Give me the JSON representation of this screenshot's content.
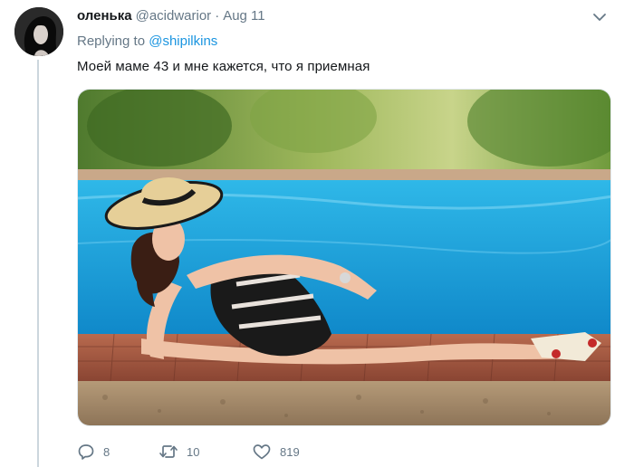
{
  "tweet": {
    "author_name": "оленька",
    "author_handle": "@acidwarior",
    "separator": "·",
    "date": "Aug 11",
    "replying_prefix": "Replying to",
    "replying_to": "@shipilkins",
    "text": "Моей маме 43 и мне кажется, что я приемная"
  },
  "actions": {
    "reply_count": "8",
    "retweet_count": "10",
    "like_count": "819"
  },
  "icons": {
    "menu": "chevron-down-icon",
    "reply": "reply-icon",
    "retweet": "retweet-icon",
    "like": "heart-icon"
  },
  "colors": {
    "link": "#1b95e0",
    "secondary_text": "#657786",
    "thread_line": "#ccd6dd"
  }
}
